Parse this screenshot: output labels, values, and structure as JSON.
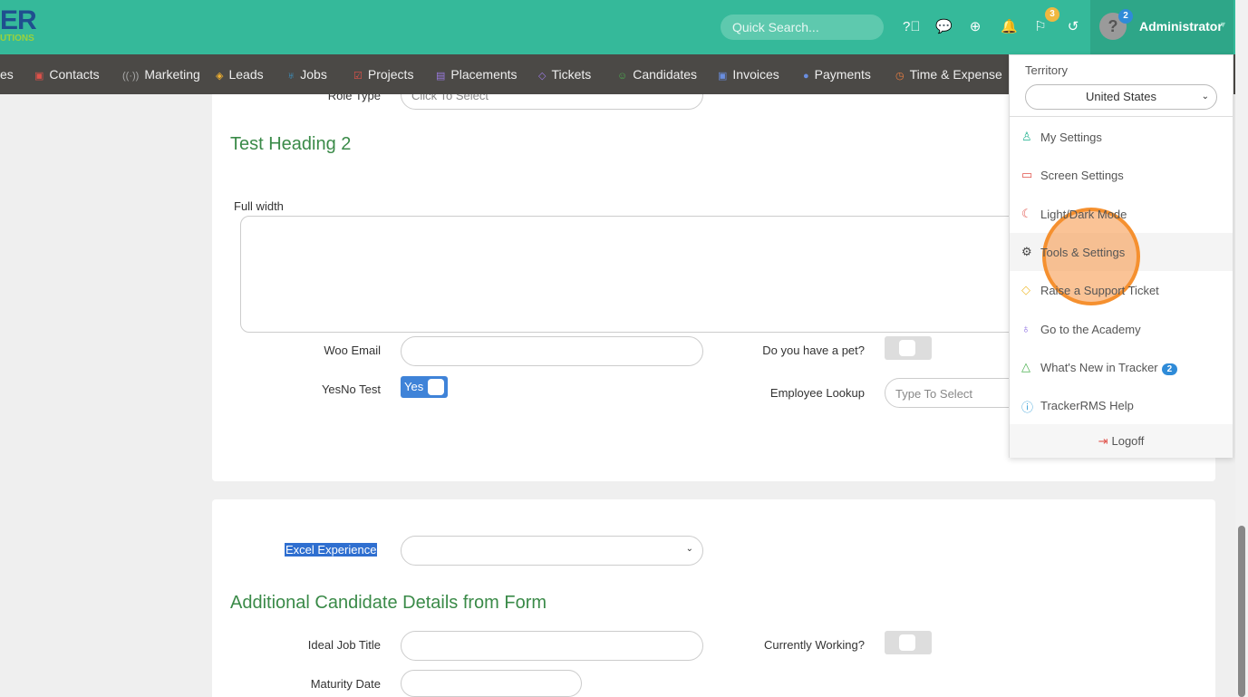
{
  "header": {
    "logo_text": "ER",
    "logo_sub": "UTIONS",
    "search_placeholder": "Quick Search...",
    "flag_badge": "3",
    "user_badge": "2",
    "user_name": "Administrator"
  },
  "nav": [
    "es",
    "Contacts",
    "Marketing",
    "Leads",
    "Jobs",
    "Projects",
    "Placements",
    "Tickets",
    "Candidates",
    "Invoices",
    "Payments",
    "Time & Expense"
  ],
  "form": {
    "role_type_label": "Role Type",
    "role_type_placeholder": "Click To Select",
    "heading1": "Test Heading 2",
    "full_width_label": "Full width",
    "woo_email_label": "Woo Email",
    "pet_label": "Do you have a pet?",
    "yesno_label": "YesNo Test",
    "yesno_value": "Yes",
    "employee_lookup_label": "Employee Lookup",
    "employee_lookup_placeholder": "Type To Select",
    "excel_label": "Excel Experience",
    "heading2": "Additional Candidate Details from Form",
    "ideal_job_label": "Ideal Job Title",
    "currently_working_label": "Currently Working?",
    "maturity_label": "Maturity Date"
  },
  "menu": {
    "territory_label": "Territory",
    "territory_value": "United States",
    "items": [
      "My Settings",
      "Screen Settings",
      "Light/Dark Mode",
      "Tools & Settings",
      "Raise a Support Ticket",
      "Go to the Academy",
      "What's New in Tracker",
      "TrackerRMS Help"
    ],
    "whats_new_badge": "2",
    "logoff": "Logoff"
  }
}
